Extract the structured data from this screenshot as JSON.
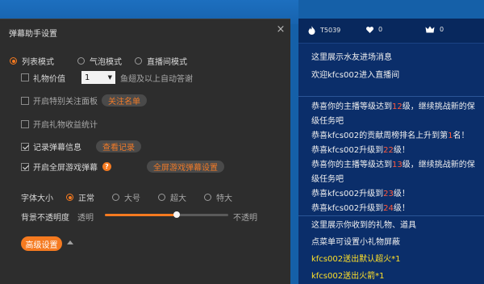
{
  "dialog": {
    "title": "弹幕助手设置",
    "close_glyph": "×",
    "display_modes": [
      {
        "label": "列表模式",
        "selected": true
      },
      {
        "label": "气泡模式",
        "selected": false
      },
      {
        "label": "直播间模式",
        "selected": false
      }
    ],
    "gift_value": {
      "label": "礼物价值",
      "select_value": "1",
      "suffix": "鱼翅及以上自动答谢",
      "checked": false
    },
    "special_follow": {
      "label": "开启特别关注面板",
      "button": "关注名单",
      "checked": false
    },
    "gift_stats": {
      "label": "开启礼物收益统计",
      "checked": false
    },
    "record": {
      "label": "记录弹幕信息",
      "button": "查看记录",
      "checked": true
    },
    "fullscreen": {
      "label": "开启全屏游戏弹幕",
      "help": "?",
      "button": "全屏游戏弹幕设置",
      "checked": true
    },
    "font_size": {
      "label": "字体大小",
      "options": [
        {
          "label": "正常",
          "selected": true
        },
        {
          "label": "大号",
          "selected": false
        },
        {
          "label": "超大",
          "selected": false
        },
        {
          "label": "特大",
          "selected": false
        }
      ]
    },
    "opacity": {
      "label": "背景不透明度",
      "left_label": "透明",
      "right_label": "不透明",
      "value_fraction": 0.58
    },
    "advanced_button": "高级设置"
  },
  "chat": {
    "stats": [
      {
        "icon": "flame-icon",
        "value": "T5039"
      },
      {
        "icon": "heart-icon",
        "value": "0"
      },
      {
        "icon": "crown-icon",
        "value": "0"
      }
    ],
    "water_messages": [
      "这里展示水友进场消息",
      "欢迎kfcs002进入直播间"
    ],
    "notice_messages": [
      {
        "pre": "恭喜你的主播等级达到",
        "hl": "12",
        "post": "级，继续挑战新的保"
      },
      {
        "pre": "级任务吧",
        "hl": "",
        "post": ""
      },
      {
        "pre": "恭喜kfcs002的贡献周榜排名上升到第",
        "hl": "1",
        "post": "名！"
      },
      {
        "pre": "恭喜kfcs002升级到",
        "hl": "22",
        "post": "级！"
      },
      {
        "pre": "恭喜你的主播等级达到",
        "hl": "13",
        "post": "级，继续挑战新的保"
      },
      {
        "pre": "级任务吧",
        "hl": "",
        "post": ""
      },
      {
        "pre": "恭喜kfcs002升级到",
        "hl": "23",
        "post": "级！"
      },
      {
        "pre": "恭喜kfcs002升级到",
        "hl": "24",
        "post": "级！"
      }
    ],
    "gift_messages": [
      {
        "pre": "这里展示你收到的礼物、道具",
        "hl": "",
        "post": ""
      },
      {
        "pre": "点菜单可设置小礼物屏蔽",
        "hl": "",
        "post": ""
      },
      {
        "pre": "kfcs002送出",
        "hl": "默认超火*1",
        "post": ""
      },
      {
        "pre": "kfcs002送出",
        "hl": "火箭*1",
        "post": ""
      }
    ]
  },
  "colors": {
    "accent": "#f57a20",
    "highlight_red": "#ff5a3c",
    "highlight_yellow": "#ffe028",
    "dialog_bg": "#2d2d2d",
    "chat_bg": "#0b2e6a"
  }
}
